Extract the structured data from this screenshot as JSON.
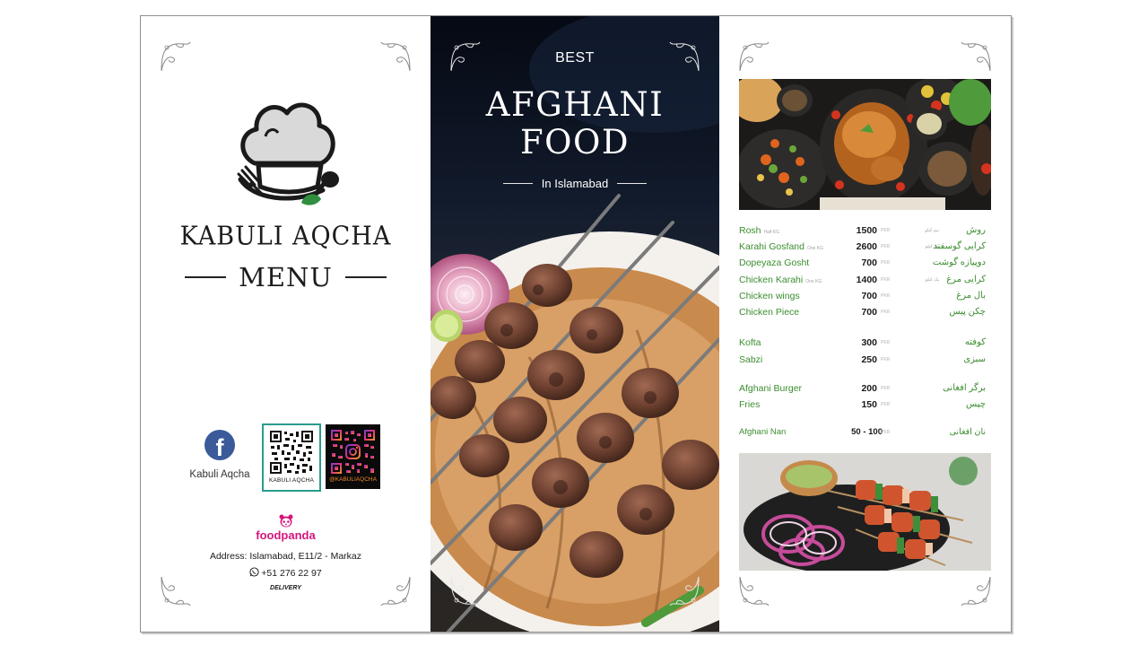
{
  "left_panel": {
    "brand": "KABULI AQCHA",
    "menu_title": "MENU",
    "facebook_label": "Kabuli Aqcha",
    "qr_caption": "KABULI AQCHA",
    "instagram_caption": "@KABULIAQCHA",
    "delivery_brand": "foodpanda",
    "address": "Address: Islamabad, E11/2 - Markaz",
    "phone": "+51 276 22 97",
    "delivery": "DELIVERY"
  },
  "middle_panel": {
    "eyebrow": "BEST",
    "title_line1": "AFGHANI",
    "title_line2": "FOOD",
    "location": "In Islamabad"
  },
  "right_panel": {
    "items": [
      {
        "en": "Rosh",
        "note": "Half KG",
        "price": "1500",
        "currency": "PKR",
        "ur": "روش",
        "ur_note": "نیم کیلو"
      },
      {
        "en": "Karahi Gosfand",
        "note": "One KG",
        "price": "2600",
        "currency": "PKR",
        "ur": "کرایی گوسفند",
        "ur_note": "یک کیلو"
      },
      {
        "en": "Dopeyaza Gosht",
        "note": "",
        "price": "700",
        "currency": "PKR",
        "ur": "دوپیازه گوشت",
        "ur_note": ""
      },
      {
        "en": "Chicken Karahi",
        "note": "One KG",
        "price": "1400",
        "currency": "PKR",
        "ur": "کرایی مرغ",
        "ur_note": "یک کیلو"
      },
      {
        "en": "Chicken wings",
        "note": "",
        "price": "700",
        "currency": "PKR",
        "ur": "بال مرغ",
        "ur_note": ""
      },
      {
        "en": "Chicken Piece",
        "note": "",
        "price": "700",
        "currency": "PKR",
        "ur": "چکن پیس",
        "ur_note": ""
      },
      {
        "en": "Kofta",
        "note": "",
        "price": "300",
        "currency": "PKR",
        "ur": "کوفته",
        "ur_note": ""
      },
      {
        "en": "Sabzi",
        "note": "",
        "price": "250",
        "currency": "PKR",
        "ur": "سبزی",
        "ur_note": ""
      },
      {
        "en": "Afghani Burger",
        "note": "",
        "price": "200",
        "currency": "PKR",
        "ur": "برگر افغانی",
        "ur_note": ""
      },
      {
        "en": "Fries",
        "note": "",
        "price": "150",
        "currency": "PKR",
        "ur": "چپس",
        "ur_note": ""
      },
      {
        "en": "Afghani Nan",
        "note": "",
        "price": "50 - 100",
        "currency": "PKR",
        "ur": "نان افغانی",
        "ur_note": ""
      }
    ]
  },
  "colors": {
    "item_green": "#3b8d2f",
    "foodpanda_pink": "#d6157b",
    "facebook_blue": "#3b5a9a",
    "qr_border": "#2a9c8c",
    "mid_background": "#0c1220"
  },
  "icons": [
    "chef-hat-logo-icon",
    "facebook-icon",
    "qr-code-icon",
    "instagram-qr-icon",
    "panda-icon",
    "whatsapp-icon",
    "corner-ornament-icon"
  ]
}
